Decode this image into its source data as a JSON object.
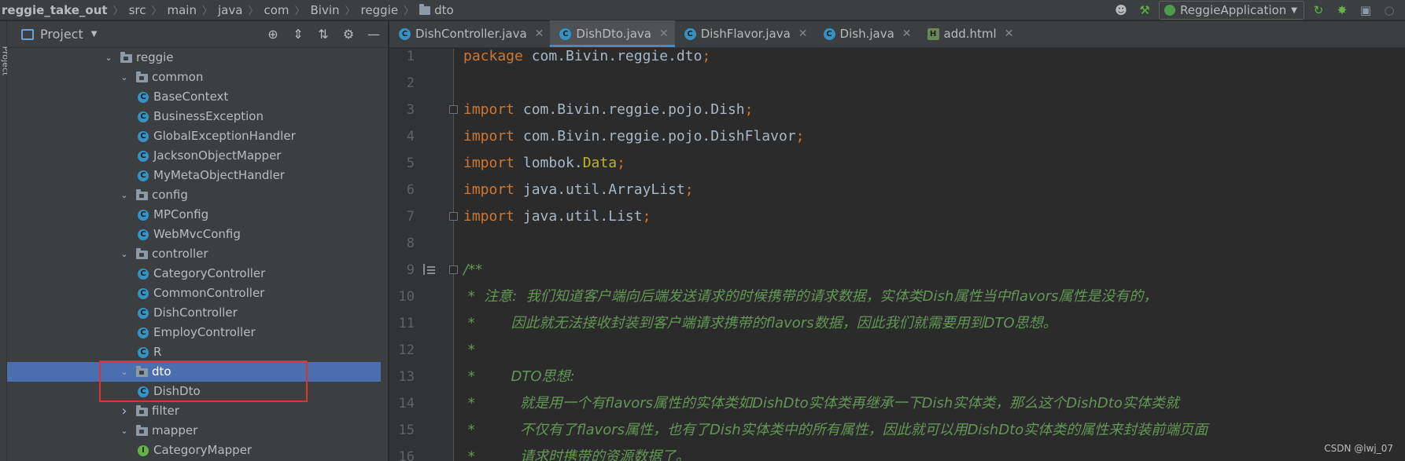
{
  "breadcrumb": [
    "reggie_take_out",
    "src",
    "main",
    "java",
    "com",
    "Bivin",
    "reggie",
    "dto"
  ],
  "toolbar": {
    "run_config": "ReggieApplication"
  },
  "project_panel": {
    "title": "Project",
    "stripe_label": "Project",
    "tree": [
      {
        "label": "reggie",
        "type": "folder",
        "expanded": true,
        "indent": 0
      },
      {
        "label": "common",
        "type": "folder",
        "expanded": true,
        "indent": 1
      },
      {
        "label": "BaseContext",
        "type": "class",
        "indent": 2
      },
      {
        "label": "BusinessException",
        "type": "class",
        "indent": 2
      },
      {
        "label": "GlobalExceptionHandler",
        "type": "class",
        "indent": 2
      },
      {
        "label": "JacksonObjectMapper",
        "type": "class",
        "indent": 2
      },
      {
        "label": "MyMetaObjectHandler",
        "type": "class",
        "indent": 2
      },
      {
        "label": "config",
        "type": "folder",
        "expanded": true,
        "indent": 1
      },
      {
        "label": "MPConfig",
        "type": "class",
        "indent": 2
      },
      {
        "label": "WebMvcConfig",
        "type": "class",
        "indent": 2
      },
      {
        "label": "controller",
        "type": "folder",
        "expanded": true,
        "indent": 1
      },
      {
        "label": "CategoryController",
        "type": "class",
        "indent": 2
      },
      {
        "label": "CommonController",
        "type": "class",
        "indent": 2
      },
      {
        "label": "DishController",
        "type": "class",
        "indent": 2
      },
      {
        "label": "EmployController",
        "type": "class",
        "indent": 2
      },
      {
        "label": "R",
        "type": "class",
        "indent": 2
      },
      {
        "label": "dto",
        "type": "folder",
        "expanded": true,
        "indent": 1,
        "selected": true
      },
      {
        "label": "DishDto",
        "type": "class",
        "indent": 2
      },
      {
        "label": "filter",
        "type": "folder",
        "expanded": false,
        "indent": 1
      },
      {
        "label": "mapper",
        "type": "folder",
        "expanded": true,
        "indent": 1
      },
      {
        "label": "CategoryMapper",
        "type": "interface",
        "indent": 2
      }
    ]
  },
  "tabs": [
    {
      "label": "DishController.java",
      "icon": "C",
      "active": false
    },
    {
      "label": "DishDto.java",
      "icon": "C",
      "active": true
    },
    {
      "label": "DishFlavor.java",
      "icon": "C",
      "active": false
    },
    {
      "label": "Dish.java",
      "icon": "C",
      "active": false
    },
    {
      "label": "add.html",
      "icon": "H",
      "active": false
    }
  ],
  "editor": {
    "lines": [
      {
        "n": "1",
        "tokens": [
          {
            "t": "package ",
            "c": "kw"
          },
          {
            "t": "com.Bivin.reggie.dto",
            "c": ""
          },
          {
            "t": ";",
            "c": "kw"
          }
        ]
      },
      {
        "n": "2",
        "tokens": []
      },
      {
        "n": "3",
        "tokens": [
          {
            "t": "import ",
            "c": "kw"
          },
          {
            "t": "com.Bivin.reggie.pojo.Dish",
            "c": ""
          },
          {
            "t": ";",
            "c": "kw"
          }
        ]
      },
      {
        "n": "4",
        "tokens": [
          {
            "t": "import ",
            "c": "kw"
          },
          {
            "t": "com.Bivin.reggie.pojo.DishFlavor",
            "c": ""
          },
          {
            "t": ";",
            "c": "kw"
          }
        ]
      },
      {
        "n": "5",
        "tokens": [
          {
            "t": "import ",
            "c": "kw"
          },
          {
            "t": "lombok.",
            "c": ""
          },
          {
            "t": "Data",
            "c": "ann"
          },
          {
            "t": ";",
            "c": "kw"
          }
        ]
      },
      {
        "n": "6",
        "tokens": [
          {
            "t": "import ",
            "c": "kw"
          },
          {
            "t": "java.util.ArrayList",
            "c": ""
          },
          {
            "t": ";",
            "c": "kw"
          }
        ]
      },
      {
        "n": "7",
        "tokens": [
          {
            "t": "import ",
            "c": "kw"
          },
          {
            "t": "java.util.List",
            "c": ""
          },
          {
            "t": ";",
            "c": "kw"
          }
        ]
      },
      {
        "n": "8",
        "tokens": []
      },
      {
        "n": "9",
        "tokens": [
          {
            "t": "/**",
            "c": "doc"
          }
        ]
      },
      {
        "n": "10",
        "tokens": [
          {
            "t": " *  注意:  我们知道客户端向后端发送请求的时候携带的请求数据，实体类Dish属性当中flavors属性是没有的，",
            "c": "doc"
          }
        ]
      },
      {
        "n": "11",
        "tokens": [
          {
            "t": " *        因此就无法接收封装到客户端请求携带的flavors数据，因此我们就需要用到DTO思想。",
            "c": "doc"
          }
        ]
      },
      {
        "n": "12",
        "tokens": [
          {
            "t": " *",
            "c": "doc"
          }
        ]
      },
      {
        "n": "13",
        "tokens": [
          {
            "t": " *        DTO思想:",
            "c": "doc"
          }
        ]
      },
      {
        "n": "14",
        "tokens": [
          {
            "t": " *          就是用一个有flavors属性的实体类如DishDto实体类再继承一下Dish实体类，那么这个DishDto实体类就",
            "c": "doc"
          }
        ]
      },
      {
        "n": "15",
        "tokens": [
          {
            "t": " *          不仅有了flavors属性，也有了Dish实体类中的所有属性，因此就可以用DishDto实体类的属性来封装前端页面",
            "c": "doc"
          }
        ]
      },
      {
        "n": "16",
        "tokens": [
          {
            "t": " *          请求时携带的资源数据了。",
            "c": "doc"
          }
        ]
      }
    ]
  },
  "watermark": "CSDN @lwj_07"
}
